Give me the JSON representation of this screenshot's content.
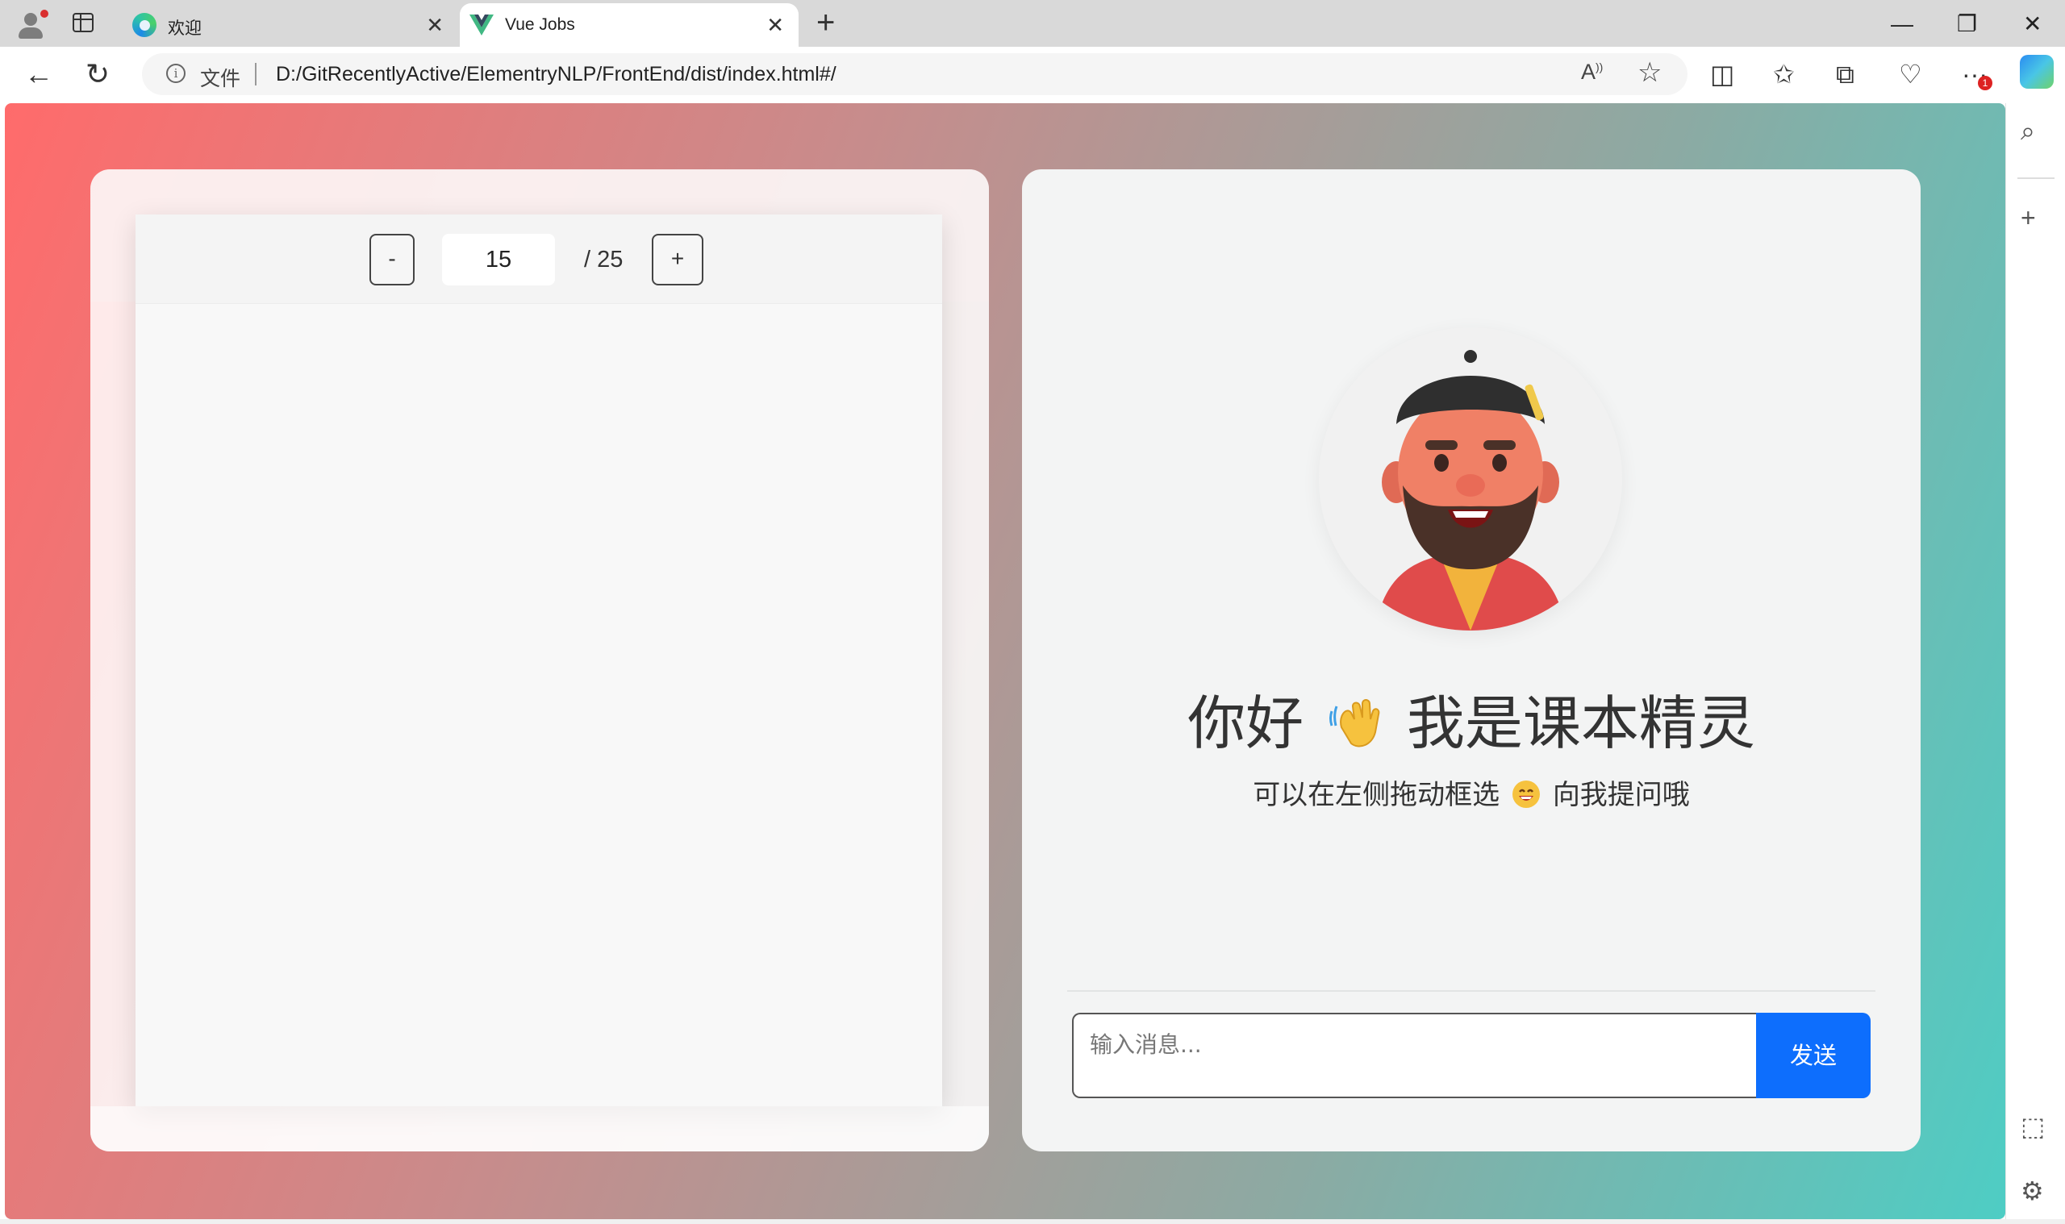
{
  "browser": {
    "tabs": [
      {
        "title": "欢迎",
        "icon": "edge-logo-icon",
        "active": false
      },
      {
        "title": "Vue Jobs",
        "icon": "vue-logo-icon",
        "active": true
      }
    ],
    "address": {
      "label": "文件",
      "url": "D:/GitRecentlyActive/ElementryNLP/FrontEnd/dist/index.html#/"
    },
    "more_badge": "1"
  },
  "viewer": {
    "minus_label": "-",
    "plus_label": "+",
    "current_page": "15",
    "total_pages": "/ 25"
  },
  "chat": {
    "greeting_pre": "你好",
    "greeting_post": "我是课本精灵",
    "subtitle_pre": "可以在左侧拖动框选",
    "subtitle_post": "向我提问哦",
    "input_placeholder": "输入消息...",
    "send_label": "发送"
  },
  "colors": {
    "gradient_start": "#ff6b6b",
    "gradient_end": "#4ecdc4",
    "send_button": "#0d6efd"
  }
}
